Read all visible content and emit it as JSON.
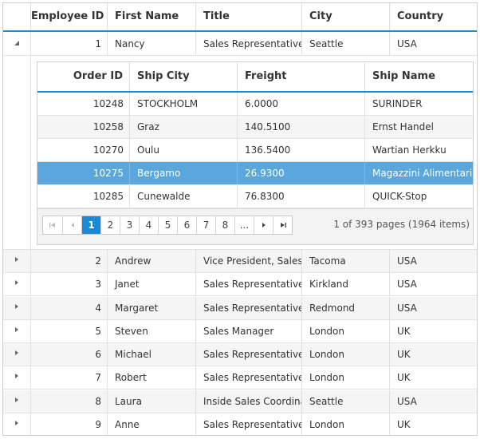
{
  "main_grid": {
    "columns": [
      "Employee ID",
      "First Name",
      "Title",
      "City",
      "Country"
    ],
    "expanded_row": {
      "employee_id": "1",
      "first_name": "Nancy",
      "title": "Sales Representative",
      "city": "Seattle",
      "country": "USA"
    },
    "rows": [
      {
        "employee_id": "2",
        "first_name": "Andrew",
        "title": "Vice President, Sales",
        "city": "Tacoma",
        "country": "USA"
      },
      {
        "employee_id": "3",
        "first_name": "Janet",
        "title": "Sales Representative",
        "city": "Kirkland",
        "country": "USA"
      },
      {
        "employee_id": "4",
        "first_name": "Margaret",
        "title": "Sales Representative",
        "city": "Redmond",
        "country": "USA"
      },
      {
        "employee_id": "5",
        "first_name": "Steven",
        "title": "Sales Manager",
        "city": "London",
        "country": "UK"
      },
      {
        "employee_id": "6",
        "first_name": "Michael",
        "title": "Sales Representative",
        "city": "London",
        "country": "UK"
      },
      {
        "employee_id": "7",
        "first_name": "Robert",
        "title": "Sales Representative",
        "city": "London",
        "country": "UK"
      },
      {
        "employee_id": "8",
        "first_name": "Laura",
        "title": "Inside Sales Coordinator",
        "city": "Seattle",
        "country": "USA"
      },
      {
        "employee_id": "9",
        "first_name": "Anne",
        "title": "Sales Representative",
        "city": "London",
        "country": "UK"
      }
    ]
  },
  "detail_grid": {
    "columns": [
      "Order ID",
      "Ship City",
      "Freight",
      "Ship Name"
    ],
    "rows": [
      {
        "order_id": "10248",
        "ship_city": "STOCKHOLM",
        "freight": "6.0000",
        "ship_name": "SURINDER"
      },
      {
        "order_id": "10258",
        "ship_city": "Graz",
        "freight": "140.5100",
        "ship_name": "Ernst Handel"
      },
      {
        "order_id": "10270",
        "ship_city": "Oulu",
        "freight": "136.5400",
        "ship_name": "Wartian Herkku"
      },
      {
        "order_id": "10275",
        "ship_city": "Bergamo",
        "freight": "26.9300",
        "ship_name": "Magazzini Alimentari Riuniti"
      },
      {
        "order_id": "10285",
        "ship_city": "Cunewalde",
        "freight": "76.8300",
        "ship_name": "QUICK-Stop"
      }
    ],
    "selected_index": 3,
    "pager": {
      "pages": [
        "1",
        "2",
        "3",
        "4",
        "5",
        "6",
        "7",
        "8",
        "..."
      ],
      "active_page": "1",
      "info": "1 of 393 pages (1964 items)"
    }
  },
  "icons": {
    "collapse": "triangle-down-left",
    "expand": "triangle-right",
    "first_page": "first-page",
    "prev_page": "prev-page",
    "next_page": "next-page",
    "last_page": "last-page"
  },
  "colors": {
    "accent": "#1a8ad4",
    "selected_row": "#5aa7dd",
    "alt_row": "#f5f5f5"
  }
}
